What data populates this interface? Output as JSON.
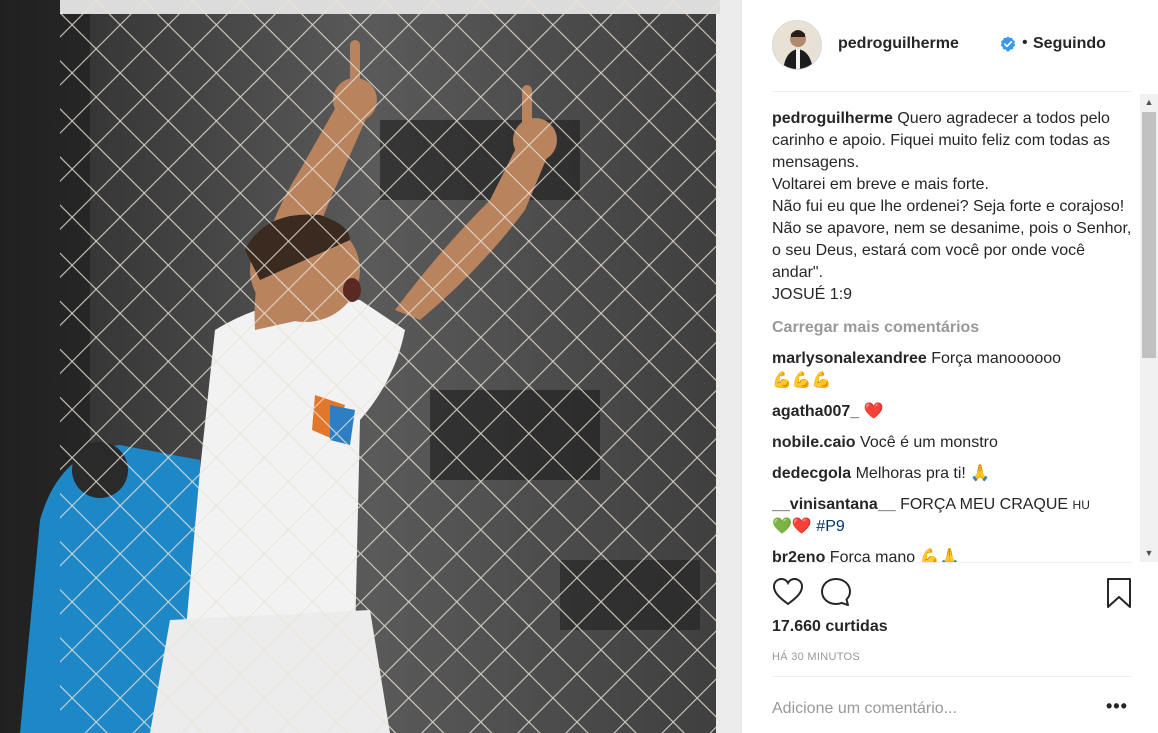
{
  "post": {
    "username": "pedroguilherme",
    "separator": "•",
    "follow_status": "Seguindo",
    "caption": "Quero agradecer a todos pelo carinho e apoio. Fiquei muito feliz com todas as mensagens.\nVoltarei em breve e mais forte.\nNão fui eu que lhe ordenei? Seja forte e corajoso! Não se apavore, nem se desanime, pois o Senhor, o seu Deus, estará com você por onde você andar\".\nJOSUÉ 1:9",
    "load_more": "Carregar mais comentários",
    "comments": [
      {
        "user": "marlysonalexandree",
        "text": "Força manoooooo",
        "emoji": "💪💪💪"
      },
      {
        "user": "agatha007_",
        "text": "",
        "emoji": "❤️"
      },
      {
        "user": "nobile.caio",
        "text": "Você é um monstro",
        "emoji": ""
      },
      {
        "user": "dedecgola",
        "text": "Melhoras pra ti!",
        "emoji": "🙏"
      },
      {
        "user": "__vinisantana__",
        "text": "FORÇA MEU CRAQUE",
        "small": "HU",
        "emoji": "💚❤️",
        "hashtag": "#P9"
      },
      {
        "user": "br2eno",
        "text": "Força mano",
        "emoji": "💪🙏"
      }
    ],
    "likes": "17.660 curtidas",
    "time": "HÁ 30 MINUTOS",
    "add_comment_placeholder": "Adicione um comentário...",
    "more_options": "•••"
  },
  "icons": {
    "like": "heart-icon",
    "comment": "comment-icon",
    "save": "bookmark-icon",
    "verified": "verified-badge-icon",
    "options": "more-options-icon"
  },
  "colors": {
    "text": "#262626",
    "secondary": "#999999",
    "verified": "#3897f0",
    "hashtag": "#003569",
    "divider": "#efefef"
  }
}
